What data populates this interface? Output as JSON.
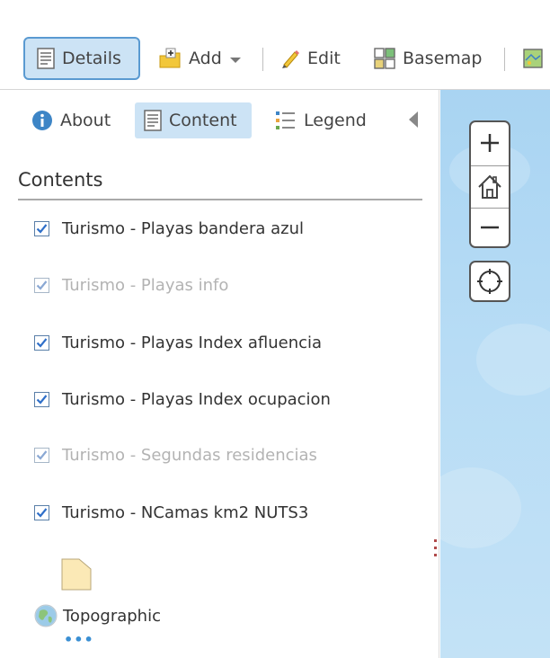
{
  "toolbar": {
    "details_label": "Details",
    "add_label": "Add",
    "edit_label": "Edit",
    "basemap_label": "Basemap"
  },
  "panel": {
    "tabs": [
      {
        "label": "About"
      },
      {
        "label": "Content"
      },
      {
        "label": "Legend"
      }
    ],
    "active_tab": "Content",
    "section_title": "Contents",
    "layers": [
      {
        "label": "Turismo - Playas bandera azul",
        "checked": true,
        "dimmed": false
      },
      {
        "label": "Turismo - Playas info",
        "checked": true,
        "dimmed": true
      },
      {
        "label": "Turismo - Playas Index afluencia",
        "checked": true,
        "dimmed": false
      },
      {
        "label": "Turismo - Playas Index ocupacion",
        "checked": true,
        "dimmed": false
      },
      {
        "label": "Turismo - Segundas residencias",
        "checked": true,
        "dimmed": true
      },
      {
        "label": "Turismo - NCamas km2 NUTS3",
        "checked": true,
        "dimmed": false
      }
    ],
    "basemap": {
      "label": "Topographic",
      "icon": "globe-icon"
    },
    "more_icon": "ellipsis-icon"
  },
  "map_controls": {
    "icons": [
      "zoom-in-icon",
      "home-icon",
      "zoom-out-icon",
      "locate-icon"
    ]
  },
  "colors": {
    "accent": "#5a9ad1",
    "active_bg": "#cce3f5",
    "map_water": "#b7dcf5",
    "dim_text": "#b3b3b3",
    "checkbox_blue": "#2f6fc9"
  }
}
